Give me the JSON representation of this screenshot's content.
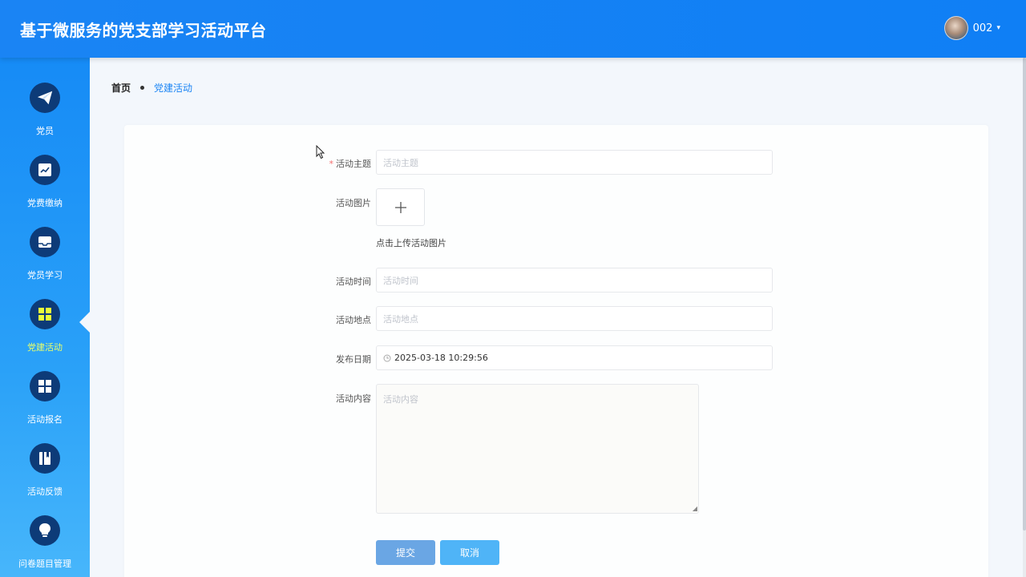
{
  "header": {
    "title": "基于微服务的党支部学习活动平台",
    "username": "002",
    "caret": "▾"
  },
  "sidebar": {
    "items": [
      {
        "label": "党员",
        "icon": "paper-plane-icon"
      },
      {
        "label": "党费缴纳",
        "icon": "trend-chart-icon"
      },
      {
        "label": "党员学习",
        "icon": "inbox-icon"
      },
      {
        "label": "党建活动",
        "icon": "grid-icon",
        "active": true
      },
      {
        "label": "活动报名",
        "icon": "grid-icon"
      },
      {
        "label": "活动反馈",
        "icon": "book-icon"
      },
      {
        "label": "问卷题目管理",
        "icon": "lightbulb-icon"
      }
    ],
    "active_color": "#e8ff6a"
  },
  "breadcrumb": {
    "home": "首页",
    "current": "党建活动"
  },
  "form": {
    "subject_label": "活动主题",
    "subject_placeholder": "活动主题",
    "required_mark": "*",
    "image_label": "活动图片",
    "upload_plus": "+",
    "upload_hint": "点击上传活动图片",
    "time_label": "活动时间",
    "time_placeholder": "活动时间",
    "location_label": "活动地点",
    "location_placeholder": "活动地点",
    "publish_label": "发布日期",
    "publish_value": "2025-03-18 10:29:56",
    "content_label": "活动内容",
    "content_placeholder": "活动内容",
    "submit": "提交",
    "cancel": "取消"
  },
  "colors": {
    "header": "#1a84f4",
    "nav_circle": "#0d3b78",
    "submit": "#6aa6e4",
    "cancel": "#4fb4f7"
  }
}
